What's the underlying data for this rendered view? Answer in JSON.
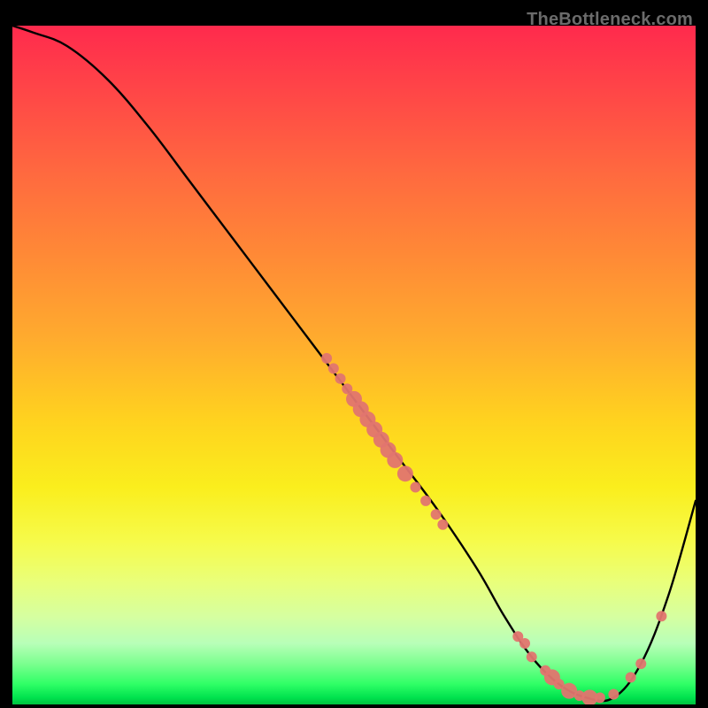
{
  "watermark": "TheBottleneck.com",
  "chart_data": {
    "type": "line",
    "title": "",
    "xlabel": "",
    "ylabel": "",
    "xlim": [
      0,
      100
    ],
    "ylim": [
      0,
      100
    ],
    "series": [
      {
        "name": "curve",
        "x": [
          0,
          3,
          8,
          14,
          20,
          26,
          32,
          38,
          44,
          50,
          56,
          62,
          68,
          72,
          76,
          80,
          84,
          88,
          92,
          96,
          100
        ],
        "y": [
          100,
          99,
          97,
          92,
          85,
          77,
          69,
          61,
          53,
          45,
          37,
          29,
          20,
          13,
          7,
          3,
          1,
          1,
          6,
          16,
          30
        ]
      }
    ],
    "markers": [
      {
        "group": "left-cluster",
        "points": [
          [
            46,
            51
          ],
          [
            47,
            49.5
          ],
          [
            48,
            48
          ],
          [
            49,
            46.5
          ],
          [
            50,
            45
          ],
          [
            51,
            43.5
          ],
          [
            52,
            42
          ],
          [
            53,
            40.5
          ],
          [
            54,
            39
          ],
          [
            55,
            37.5
          ],
          [
            56,
            36
          ],
          [
            57.5,
            34
          ],
          [
            59,
            32
          ],
          [
            60.5,
            30
          ],
          [
            62,
            28
          ],
          [
            63,
            26.5
          ]
        ]
      },
      {
        "group": "bottom-cluster",
        "points": [
          [
            74,
            10
          ],
          [
            75,
            9
          ],
          [
            76,
            7
          ],
          [
            78,
            5
          ],
          [
            79,
            4
          ],
          [
            80,
            3
          ],
          [
            81.5,
            2
          ],
          [
            83,
            1.3
          ],
          [
            84.5,
            1
          ],
          [
            86,
            1
          ],
          [
            88,
            1.5
          ]
        ]
      },
      {
        "group": "right-cluster",
        "points": [
          [
            90.5,
            4
          ],
          [
            92,
            6
          ],
          [
            95,
            13
          ]
        ]
      }
    ],
    "style": {
      "line_color": "#000000",
      "line_width": 2.4,
      "marker_color": "#e2756f",
      "marker_radius_small": 6,
      "marker_radius_large": 9,
      "gradient_top": "#ff2a4d",
      "gradient_bottom": "#00c23f"
    }
  }
}
